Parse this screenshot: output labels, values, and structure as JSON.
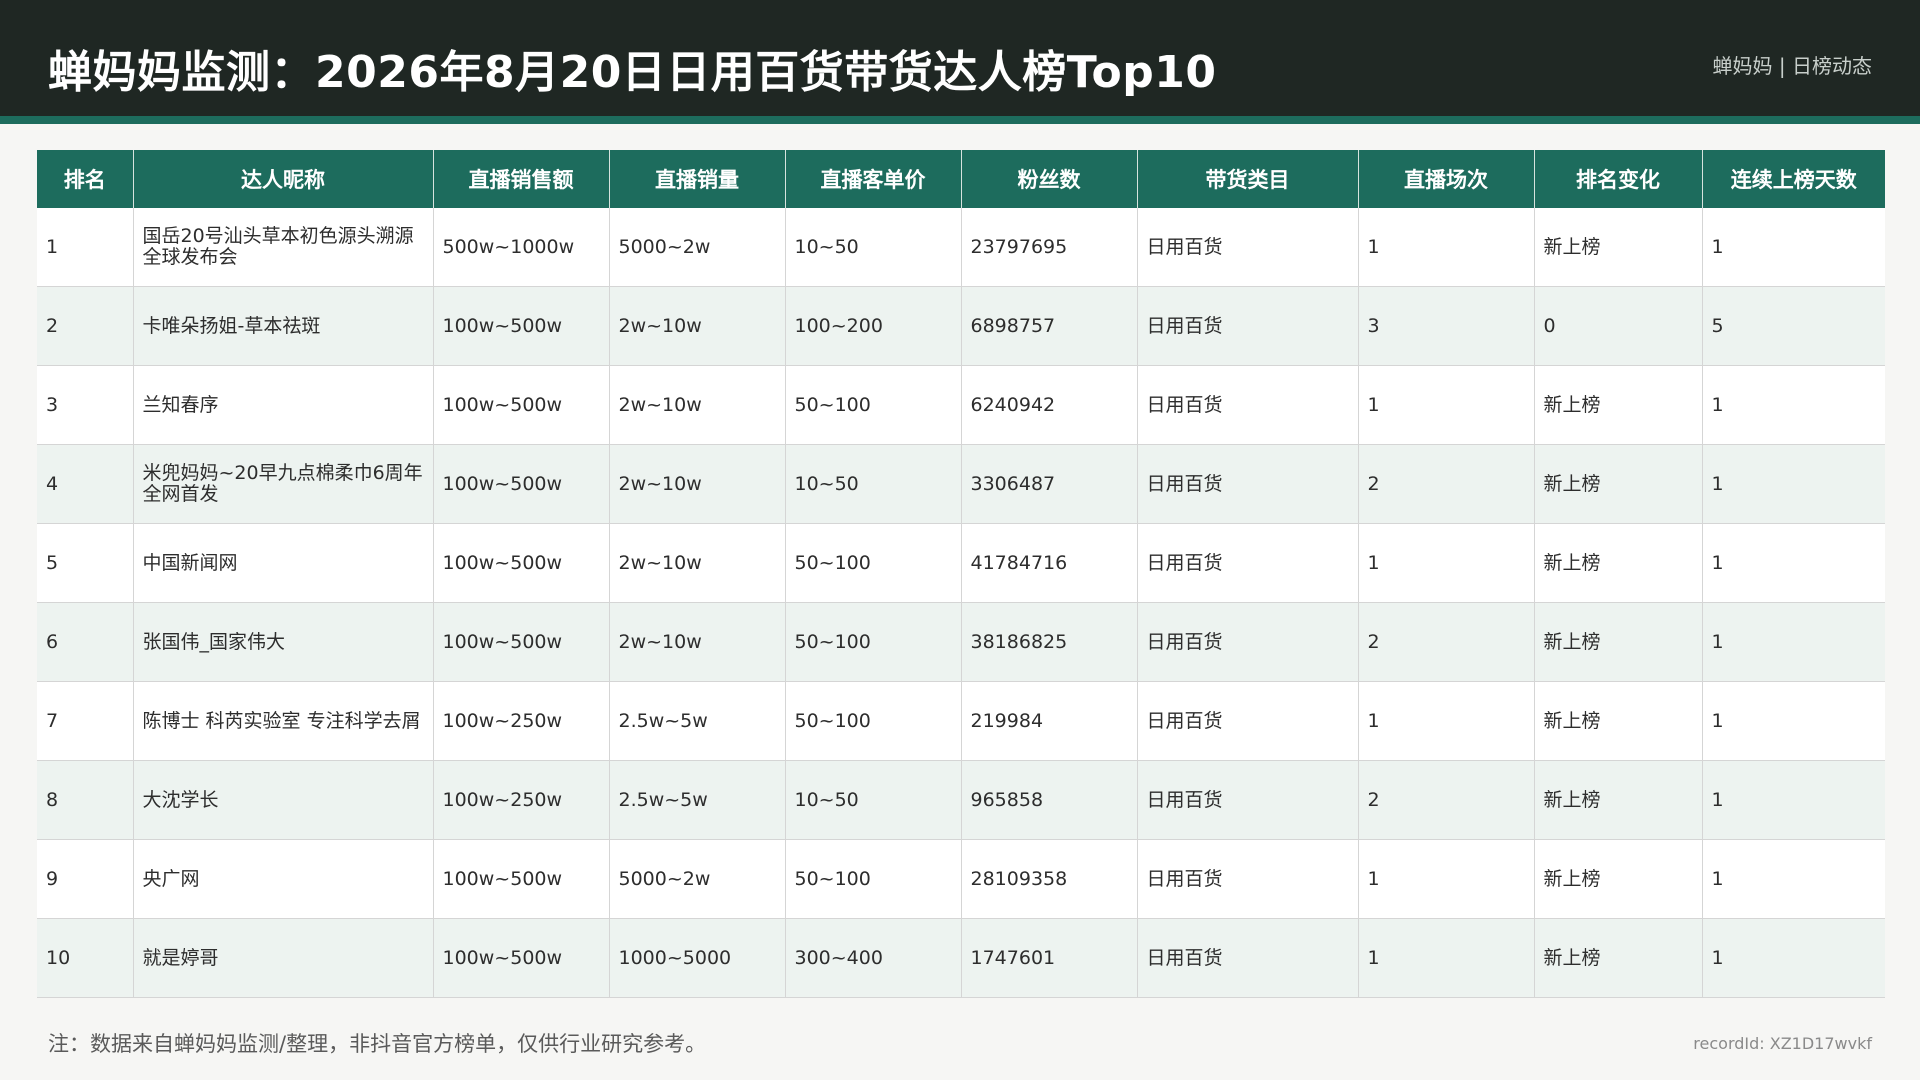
{
  "header": {
    "title": "蝉妈妈监测：2026年8月20日日用百货带货达人榜Top10",
    "brand": "蝉妈妈 | 日榜动态"
  },
  "table": {
    "columns": [
      "排名",
      "达人昵称",
      "直播销售额",
      "直播销量",
      "直播客单价",
      "粉丝数",
      "带货类目",
      "直播场次",
      "排名变化",
      "连续上榜天数"
    ],
    "rows": [
      [
        "1",
        "国岳20号汕头草本初色源头溯源全球发布会",
        "500w~1000w",
        "5000~2w",
        "10~50",
        "23797695",
        "日用百货",
        "1",
        "新上榜",
        "1"
      ],
      [
        "2",
        "卡唯朵扬姐-草本祛斑",
        "100w~500w",
        "2w~10w",
        "100~200",
        "6898757",
        "日用百货",
        "3",
        "0",
        "5"
      ],
      [
        "3",
        "兰知春序",
        "100w~500w",
        "2w~10w",
        "50~100",
        "6240942",
        "日用百货",
        "1",
        "新上榜",
        "1"
      ],
      [
        "4",
        "米兜妈妈~20早九点棉柔巾6周年全网首发",
        "100w~500w",
        "2w~10w",
        "10~50",
        "3306487",
        "日用百货",
        "2",
        "新上榜",
        "1"
      ],
      [
        "5",
        "中国新闻网",
        "100w~500w",
        "2w~10w",
        "50~100",
        "41784716",
        "日用百货",
        "1",
        "新上榜",
        "1"
      ],
      [
        "6",
        "张国伟_国家伟大",
        "100w~500w",
        "2w~10w",
        "50~100",
        "38186825",
        "日用百货",
        "2",
        "新上榜",
        "1"
      ],
      [
        "7",
        "陈博士 科芮实验室 专注科学去屑",
        "100w~250w",
        "2.5w~5w",
        "50~100",
        "219984",
        "日用百货",
        "1",
        "新上榜",
        "1"
      ],
      [
        "8",
        "大沈学长",
        "100w~250w",
        "2.5w~5w",
        "10~50",
        "965858",
        "日用百货",
        "2",
        "新上榜",
        "1"
      ],
      [
        "9",
        "央广网",
        "100w~500w",
        "5000~2w",
        "50~100",
        "28109358",
        "日用百货",
        "1",
        "新上榜",
        "1"
      ],
      [
        "10",
        "就是婷哥",
        "100w~500w",
        "1000~5000",
        "300~400",
        "1747601",
        "日用百货",
        "1",
        "新上榜",
        "1"
      ]
    ]
  },
  "footer": {
    "note": "注：数据来自蝉妈妈监测/整理，非抖音官方榜单，仅供行业研究参考。",
    "record_id": "recordId: XZ1D17wvkf"
  },
  "colors": {
    "header_bg": "#1f2723",
    "accent": "#1d6c5d",
    "row_alt": "#edf3f0"
  }
}
